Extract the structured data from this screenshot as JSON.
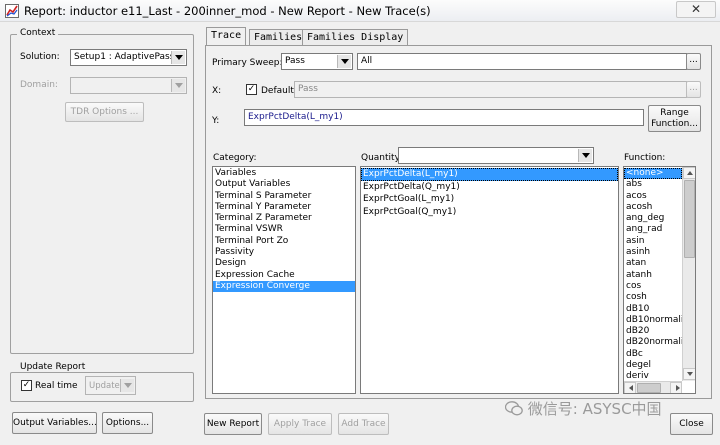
{
  "window": {
    "title": "Report: inductor e11_Last - 200inner_mod - New Report - New Trace(s)",
    "close_glyph": "✕",
    "icon": "app-report-icon"
  },
  "context": {
    "group_label": "Context",
    "solution_label": "Solution:",
    "solution_value": "Setup1 : AdaptivePass",
    "domain_label": "Domain:",
    "domain_value": "",
    "tdr_options_label": "TDR Options ..."
  },
  "update_report": {
    "group_label": "Update Report",
    "real_time_label": "Real time",
    "real_time_checked": "✓",
    "update_label": "Update"
  },
  "bottom_buttons": {
    "output_variables": "Output Variables...",
    "options": "Options...",
    "new_report": "New Report",
    "apply_trace": "Apply Trace",
    "add_trace": "Add Trace",
    "close": "Close"
  },
  "tabs": [
    "Trace",
    "Families",
    "Families Display"
  ],
  "trace": {
    "primary_sweep_label": "Primary Sweep:",
    "primary_sweep_value": "Pass",
    "primary_sweep_all": "All",
    "ellipsis": "...",
    "x_label": "X:",
    "x_default_label": "Default",
    "x_default_checked": "✓",
    "x_value": "Pass",
    "y_label": "Y:",
    "y_value": "ExprPctDelta(L_my1)",
    "range_function_line1": "Range",
    "range_function_line2": "Function..."
  },
  "category": {
    "label": "Category:",
    "items": [
      "Variables",
      "Output Variables",
      "Terminal S Parameter",
      "Terminal Y Parameter",
      "Terminal Z Parameter",
      "Terminal VSWR",
      "Terminal Port Zo",
      "Passivity",
      "Design",
      "Expression Cache",
      "Expression Converge"
    ],
    "selected": "Expression Converge"
  },
  "quantity": {
    "label": "Quantity:",
    "filter_value": "",
    "items": [
      "ExprPctDelta(L_my1)",
      "ExprPctDelta(Q_my1)",
      "ExprPctGoal(L_my1)",
      "ExprPctGoal(Q_my1)"
    ],
    "selected": "ExprPctDelta(L_my1)"
  },
  "function": {
    "label": "Function:",
    "items": [
      "<none>",
      "abs",
      "acos",
      "acosh",
      "ang_deg",
      "ang_rad",
      "asin",
      "asinh",
      "atan",
      "atanh",
      "cos",
      "cosh",
      "dB10",
      "dB10normaliz",
      "dB20",
      "dB20normaliz",
      "dBc",
      "degel",
      "deriv"
    ],
    "selected": "<none>"
  },
  "watermark": "微信号: ASYSC中国",
  "colors": {
    "selection": "#3399ff",
    "window_bg": "#f0f0f0"
  }
}
